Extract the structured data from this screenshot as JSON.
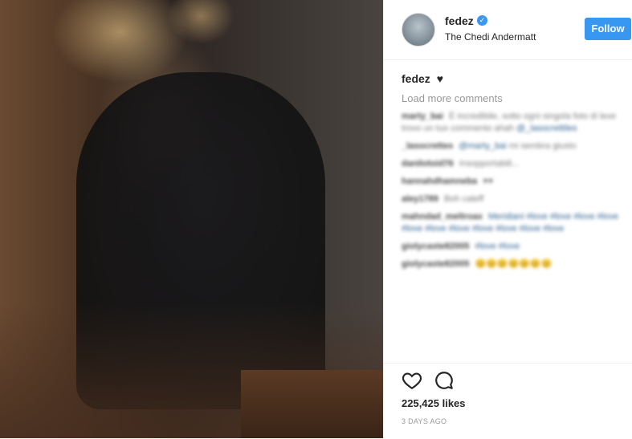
{
  "post": {
    "username": "fedez",
    "location": "The Chedi Andermatt",
    "follow_label": "Follow",
    "caption_user": "fedez",
    "caption_text": "♥",
    "load_more_label": "Load more comments",
    "likes": "225,425 likes",
    "timestamp": "3 DAYS AGO"
  },
  "comments": [
    {
      "user": "marty_bai",
      "text": "È incredibile, sotto ogni singola foto di lexe trovo un tuo commento ahah",
      "tag": "@_lasocrettiles"
    },
    {
      "user": "_lasocrettes",
      "text": "mi sembra giusto",
      "tag": "@marty_bai"
    },
    {
      "user": "danilotoid76",
      "text": "Insopportabili...",
      "tag": ""
    },
    {
      "user": "hannahdhamneba",
      "text": "♥♥",
      "tag": ""
    },
    {
      "user": "aley1789",
      "text": "Boh cateff",
      "tag": ""
    },
    {
      "user": "mahndad_meltroax",
      "text": "Meridiani #love #love #love #love #love #love #love #love #love #love #love",
      "tag": ""
    },
    {
      "user": "giolycaste82005",
      "text": "#love #love",
      "tag": ""
    },
    {
      "user": "giolycaste82005",
      "text": "😊😊😊😊😊😊😊",
      "tag": ""
    }
  ],
  "icons": {
    "verified": "verified-badge-icon",
    "like": "heart-outline-icon",
    "comment": "speech-bubble-icon"
  },
  "colors": {
    "accent": "#3897f0",
    "text": "#262626",
    "muted": "#999999"
  }
}
